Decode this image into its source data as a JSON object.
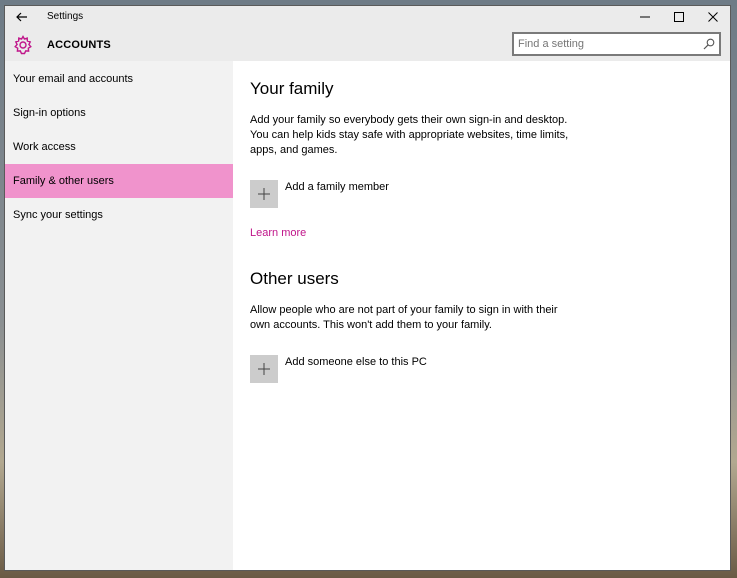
{
  "window": {
    "title": "Settings"
  },
  "header": {
    "section_title": "ACCOUNTS",
    "search_placeholder": "Find a setting"
  },
  "sidebar": {
    "items": [
      {
        "label": "Your email and accounts"
      },
      {
        "label": "Sign-in options"
      },
      {
        "label": "Work access"
      },
      {
        "label": "Family & other users"
      },
      {
        "label": "Sync your settings"
      }
    ],
    "active_index": 3
  },
  "content": {
    "family": {
      "heading": "Your family",
      "description": "Add your family so everybody gets their own sign-in and desktop. You can help kids stay safe with appropriate websites, time limits, apps, and games.",
      "add_label": "Add a family member",
      "learn_more": "Learn more"
    },
    "other_users": {
      "heading": "Other users",
      "description": "Allow people who are not part of your family to sign in with their own accounts. This won't add them to your family.",
      "add_label": "Add someone else to this PC"
    }
  },
  "colors": {
    "accent": "#f093cc",
    "link": "#c0168a",
    "gear": "#c0168a"
  }
}
